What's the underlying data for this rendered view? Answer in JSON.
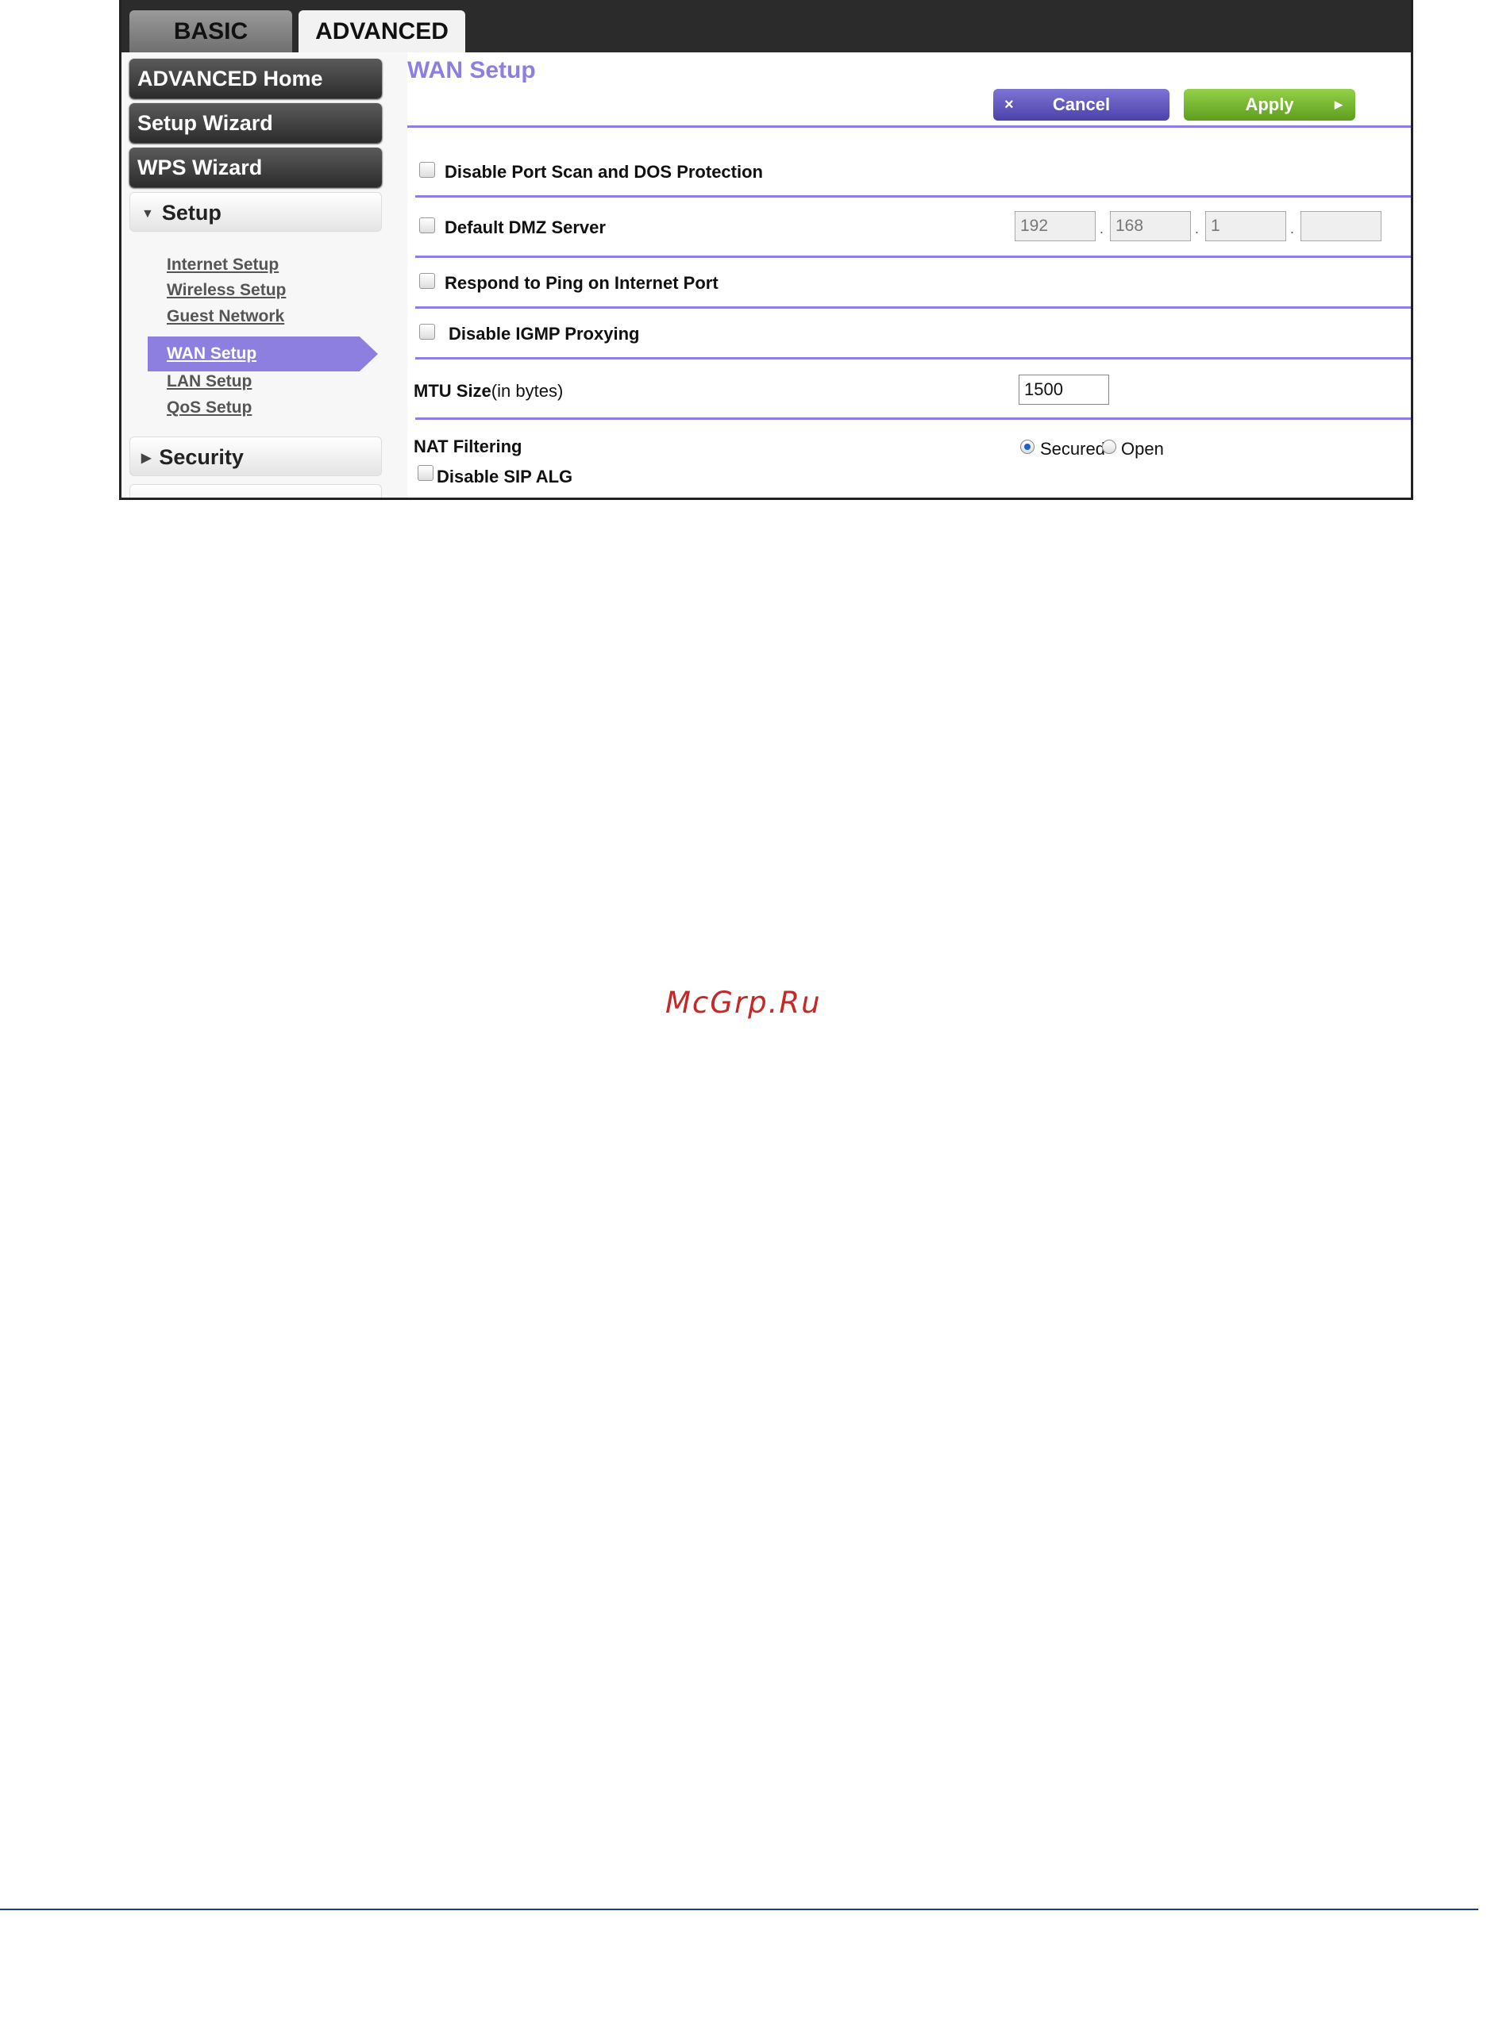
{
  "tabs": {
    "basic": "BASIC",
    "advanced": "ADVANCED"
  },
  "sidebar": {
    "advanced_home": "ADVANCED Home",
    "setup_wizard": "Setup Wizard",
    "wps_wizard": "WPS Wizard",
    "setup_section": {
      "label": "Setup",
      "caret": "▼"
    },
    "setup_links": [
      "Internet Setup",
      "Wireless Setup",
      "Guest Network",
      "WAN Setup",
      "LAN Setup",
      "QoS Setup"
    ],
    "active_link": "WAN Setup",
    "security_section": {
      "label": "Security",
      "caret": "▶"
    }
  },
  "main": {
    "title": "WAN Setup",
    "cancel_label": "Cancel",
    "cancel_icon": "×",
    "apply_label": "Apply",
    "apply_icon": "▶",
    "options": {
      "port_scan": "Disable Port Scan and DOS Protection",
      "dmz": "Default DMZ Server",
      "ping": "Respond to Ping on Internet Port",
      "igmp": "Disable IGMP Proxying",
      "sip_alg": "Disable SIP ALG"
    },
    "dmz_ip": [
      "192",
      "168",
      "1",
      ""
    ],
    "ip_separator": ".",
    "mtu_label": "MTU Size",
    "mtu_unit": "(in bytes)",
    "mtu_value": "1500",
    "nat_label": "NAT Filtering",
    "nat_options": {
      "secured": "Secured",
      "open": "Open"
    },
    "nat_selected": "Secured"
  },
  "watermark": "McGrp.Ru",
  "colors": {
    "accent": "#8d7fe0",
    "cancel": "#5a50b8",
    "apply": "#77b52f",
    "watermark": "#c62828",
    "footer_rule": "#1e3c8c"
  }
}
